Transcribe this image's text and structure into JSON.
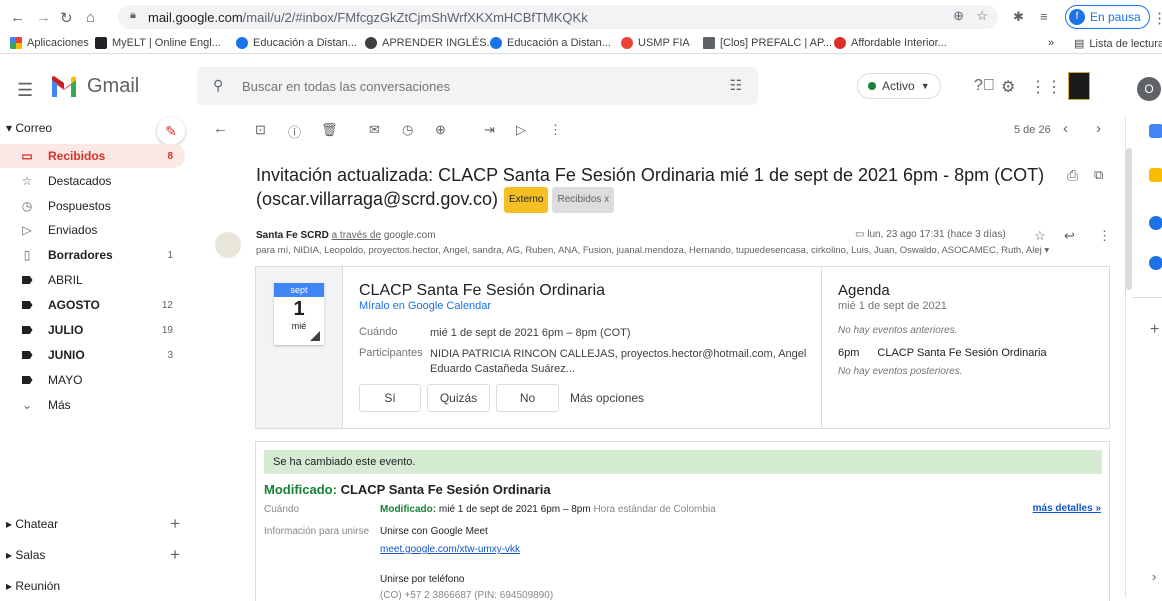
{
  "browser": {
    "url_host": "mail.google.com",
    "url_path": "/mail/u/2/#inbox/FMfcgzGkZtCjmShWrfXKXmHCBfTMKQKk",
    "paused_avatar": "f",
    "paused_label": "En pausa",
    "bookmarks": [
      {
        "label": "Aplicaciones",
        "color": "#ea4335"
      },
      {
        "label": "MyELT | Online Engl...",
        "color": "#202124"
      },
      {
        "label": "Educación a Distan...",
        "color": "#1a73e8"
      },
      {
        "label": "APRENDER INGLÉS...",
        "color": "#3c4043"
      },
      {
        "label": "Educación a Distan...",
        "color": "#1a73e8"
      },
      {
        "label": "USMP FIA",
        "color": "#ea4335"
      },
      {
        "label": "[Clos] PREFALC | AP...",
        "color": "#5f6368"
      },
      {
        "label": "Affordable Interior...",
        "color": "#d93025"
      }
    ],
    "reading_list": "Lista de lectura"
  },
  "header": {
    "app_name": "Gmail",
    "search_placeholder": "Buscar en todas las conversaciones",
    "status_label": "Activo",
    "user_initial": "O"
  },
  "sidebar": {
    "section_label": "Correo",
    "items": [
      {
        "label": "Recibidos",
        "count": "8",
        "icon": "inbox-icon",
        "glyph": "▭"
      },
      {
        "label": "Destacados",
        "count": "",
        "icon": "star-icon",
        "glyph": "☆"
      },
      {
        "label": "Pospuestos",
        "count": "",
        "icon": "clock-icon",
        "glyph": "◷"
      },
      {
        "label": "Enviados",
        "count": "",
        "icon": "send-icon",
        "glyph": "▷"
      },
      {
        "label": "Borradores",
        "count": "1",
        "icon": "draft-icon",
        "glyph": "▯"
      },
      {
        "label": "ABRIL",
        "count": "",
        "icon": "label-icon",
        "glyph": ""
      },
      {
        "label": "AGOSTO",
        "count": "12",
        "icon": "label-icon",
        "glyph": ""
      },
      {
        "label": "JULIO",
        "count": "19",
        "icon": "label-icon",
        "glyph": ""
      },
      {
        "label": "JUNIO",
        "count": "3",
        "icon": "label-icon",
        "glyph": ""
      },
      {
        "label": "MAYO",
        "count": "",
        "icon": "label-icon",
        "glyph": ""
      },
      {
        "label": "Más",
        "count": "",
        "icon": "chevron-down-icon",
        "glyph": "⌄"
      }
    ],
    "chat_label": "Chatear",
    "rooms_label": "Salas",
    "meeting_label": "Reunión"
  },
  "toolbar": {
    "counter": "5 de 26"
  },
  "email": {
    "subject": "Invitación actualizada: CLACP Santa Fe Sesión Ordinaria mié 1 de sept de 2021 6pm - 8pm (COT) (oscar.villarraga@scrd.gov.co)",
    "badge_external": "Externo",
    "badge_inbox": "Recibidos x",
    "sender_name": "Santa Fe SCRD",
    "via_text": "a través de",
    "via_domain": "google.com",
    "recipients": "para mí, NIDIA, Leopoldo, proyectos.hector, Angel, sandra, AG, Ruben, ANA, Fusion, juanal.mendoza, Hernando, tupuedesencasa, cirkolino, Luis, Juan, Oswaldo, ASOCAMEC, Ruth, Alej ▾",
    "date": "lun, 23 ago 17:31 (hace 3 días)"
  },
  "event": {
    "month": "sept",
    "day": "1",
    "weekday": "mié",
    "title": "CLACP Santa Fe Sesión Ordinaria",
    "calendar_link": "Míralo en Google Calendar",
    "when_label": "Cuándo",
    "when_value": "mié 1 de sept de 2021 6pm – 8pm (COT)",
    "participants_label": "Participantes",
    "participants_value": "NIDIA PATRICIA RINCON CALLEJAS, proyectos.hector@hotmail.com, Angel Eduardo Castañeda Suárez...",
    "rsvp_yes": "Sí",
    "rsvp_maybe": "Quizás",
    "rsvp_no": "No",
    "more_options": "Más opciones",
    "agenda_title": "Agenda",
    "agenda_date": "mié 1 de sept de 2021",
    "agenda_no_prev": "No hay eventos anteriores.",
    "agenda_time": "6pm",
    "agenda_event": "CLACP Santa Fe Sesión Ordinaria",
    "agenda_no_next": "No hay eventos posteriores."
  },
  "change": {
    "banner": "Se ha cambiado este evento.",
    "modified_prefix": "Modificado:",
    "title": "CLACP Santa Fe Sesión Ordinaria",
    "when_label": "Cuándo",
    "when_mod": "Modificado:",
    "when_value": "mié 1 de sept de 2021 6pm – 8pm",
    "when_tz": "Hora estándar de Colombia",
    "more_details": "más detalles »",
    "join_label": "Información para unirse",
    "join_meet": "Unirse con Google Meet",
    "meet_link": "meet.google.com/xtw-umxy-vkk",
    "join_phone": "Unirse por teléfono",
    "phone_line": "(CO) +57 2 3866687 (PIN: 694509890)"
  }
}
